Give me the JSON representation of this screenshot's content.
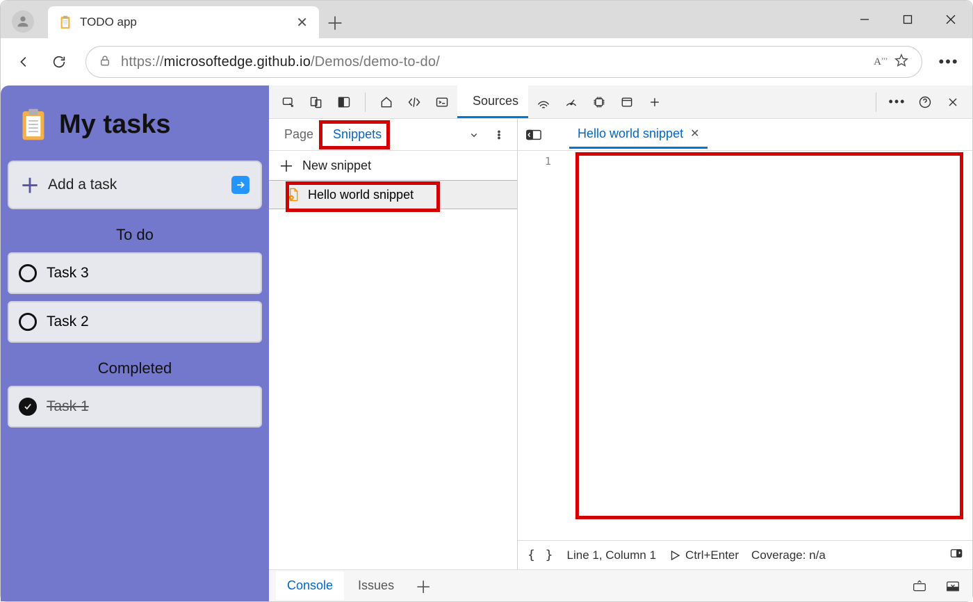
{
  "browser": {
    "tab_title": "TODO app",
    "url_prefix": "https://",
    "url_host": "microsoftedge.github.io",
    "url_path": "/Demos/demo-to-do/",
    "read_aloud": "A"
  },
  "page": {
    "title": "My tasks",
    "add_placeholder": "Add a task",
    "sections": {
      "todo": "To do",
      "done": "Completed"
    },
    "tasks_todo": [
      {
        "label": "Task 3"
      },
      {
        "label": "Task 2"
      }
    ],
    "tasks_done": [
      {
        "label": "Task 1"
      }
    ]
  },
  "devtools": {
    "main_tabs": {
      "sources": "Sources"
    },
    "nav_tabs": {
      "page": "Page",
      "snippets": "Snippets"
    },
    "new_snippet": "New snippet",
    "snippet_name": "Hello world snippet",
    "editor_tab": "Hello world snippet",
    "gutter_line": "1",
    "status": {
      "pos": "Line 1, Column 1",
      "run": "Ctrl+Enter",
      "coverage": "Coverage: n/a"
    },
    "drawer": {
      "console": "Console",
      "issues": "Issues"
    }
  }
}
